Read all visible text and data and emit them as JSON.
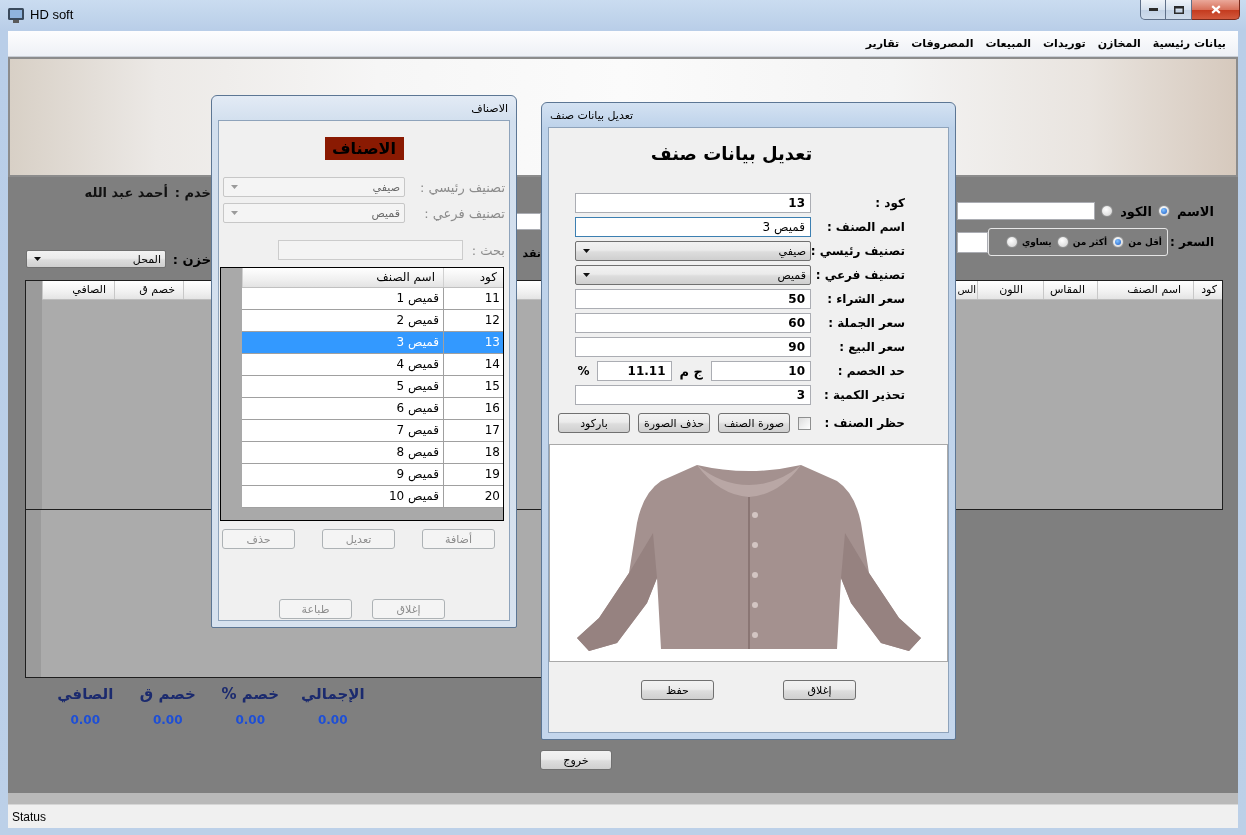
{
  "window": {
    "title": "HD soft"
  },
  "menu": [
    {
      "label": "بيانات رئيسية"
    },
    {
      "label": "المخازن"
    },
    {
      "label": "توريدات"
    },
    {
      "label": "المبيعات"
    },
    {
      "label": "المصروفات"
    },
    {
      "label": "تقارير"
    }
  ],
  "main": {
    "user": {
      "label": "خدم :",
      "value": "أحمد عبد الله"
    },
    "store": {
      "label": "خزن :",
      "value": "المحل"
    },
    "payment_label": "نقد",
    "search_by": [
      {
        "label": "الاسم",
        "selected": true
      },
      {
        "label": "الكود",
        "selected": false
      }
    ],
    "price": {
      "label": "السعر :",
      "options": [
        {
          "label": "أقل من",
          "selected": true
        },
        {
          "label": "أكثر من",
          "selected": false
        },
        {
          "label": "يساوي",
          "selected": false
        }
      ]
    },
    "grid": {
      "columns": [
        "كود",
        "اسم الصنف",
        "المقاس",
        "اللون",
        "الس"
      ],
      "columns_end": [
        "خصم ق",
        "الصافي"
      ]
    },
    "totals": [
      {
        "label": "الإجمالي",
        "value": "0.00"
      },
      {
        "label": "خصم %",
        "value": "0.00"
      },
      {
        "label": "خصم ق",
        "value": "0.00"
      },
      {
        "label": "الصافي",
        "value": "0.00"
      }
    ],
    "exit_button": "خروج"
  },
  "items_dialog": {
    "title": "الاصناف",
    "disabled": true,
    "heading": "الاصناف",
    "filters": [
      {
        "label": "تصنيف رئيسي :",
        "value": "صيفي"
      },
      {
        "label": "تصنيف فرعي :",
        "value": "قميص"
      }
    ],
    "search": {
      "label": "بحث :"
    },
    "table": {
      "columns": [
        "كود",
        "اسم الصنف"
      ],
      "rows": [
        {
          "code": "11",
          "name": "قميص 1",
          "selected": false
        },
        {
          "code": "12",
          "name": "قميص 2",
          "selected": false
        },
        {
          "code": "13",
          "name": "قميص 3",
          "selected": true
        },
        {
          "code": "14",
          "name": "قميص 4",
          "selected": false
        },
        {
          "code": "15",
          "name": "قميص 5",
          "selected": false
        },
        {
          "code": "16",
          "name": "قميص 6",
          "selected": false
        },
        {
          "code": "17",
          "name": "قميص 7",
          "selected": false
        },
        {
          "code": "18",
          "name": "قميص 8",
          "selected": false
        },
        {
          "code": "19",
          "name": "قميص 9",
          "selected": false
        },
        {
          "code": "20",
          "name": "قميص 10",
          "selected": false
        }
      ]
    },
    "buttons": [
      "أضافة",
      "تعديل",
      "حذف"
    ],
    "footer_buttons": [
      "إغلاق",
      "طباعة"
    ]
  },
  "edit_dialog": {
    "title": "تعديل بيانات صنف",
    "heading": "تعديل بيانات صنف",
    "fields": [
      {
        "kind": "number",
        "label": "كود :",
        "value": "13",
        "focused": false
      },
      {
        "kind": "text",
        "label": "اسم الصنف :",
        "value": "قميص 3",
        "focused": true
      },
      {
        "kind": "combo",
        "label": "تصنيف رئيسي :",
        "value": "صيفي",
        "focused": false
      },
      {
        "kind": "combo",
        "label": "تصنيف فرعي :",
        "value": "قميص",
        "focused": false
      },
      {
        "kind": "number",
        "label": "سعر الشراء :",
        "value": "50",
        "focused": false
      },
      {
        "kind": "number",
        "label": "سعر الجملة :",
        "value": "60",
        "focused": false
      },
      {
        "kind": "number",
        "label": "سعر البيع :",
        "value": "90",
        "focused": false
      },
      {
        "kind": "discount",
        "label": "حد الخصم :",
        "value": "10",
        "unit": "ج م",
        "percent_value": "11.11",
        "percent_sign": "%",
        "focused": false
      },
      {
        "kind": "number",
        "label": "تحذير الكمية :",
        "value": "3",
        "focused": false
      }
    ],
    "block": {
      "label": "حظر الصنف :",
      "checked": false
    },
    "image_buttons": [
      "صورة الصنف",
      "حذف الصورة",
      "باركود"
    ],
    "buttons": [
      "إغلاق",
      "حفظ"
    ]
  },
  "status_bar": {
    "text": "Status"
  }
}
